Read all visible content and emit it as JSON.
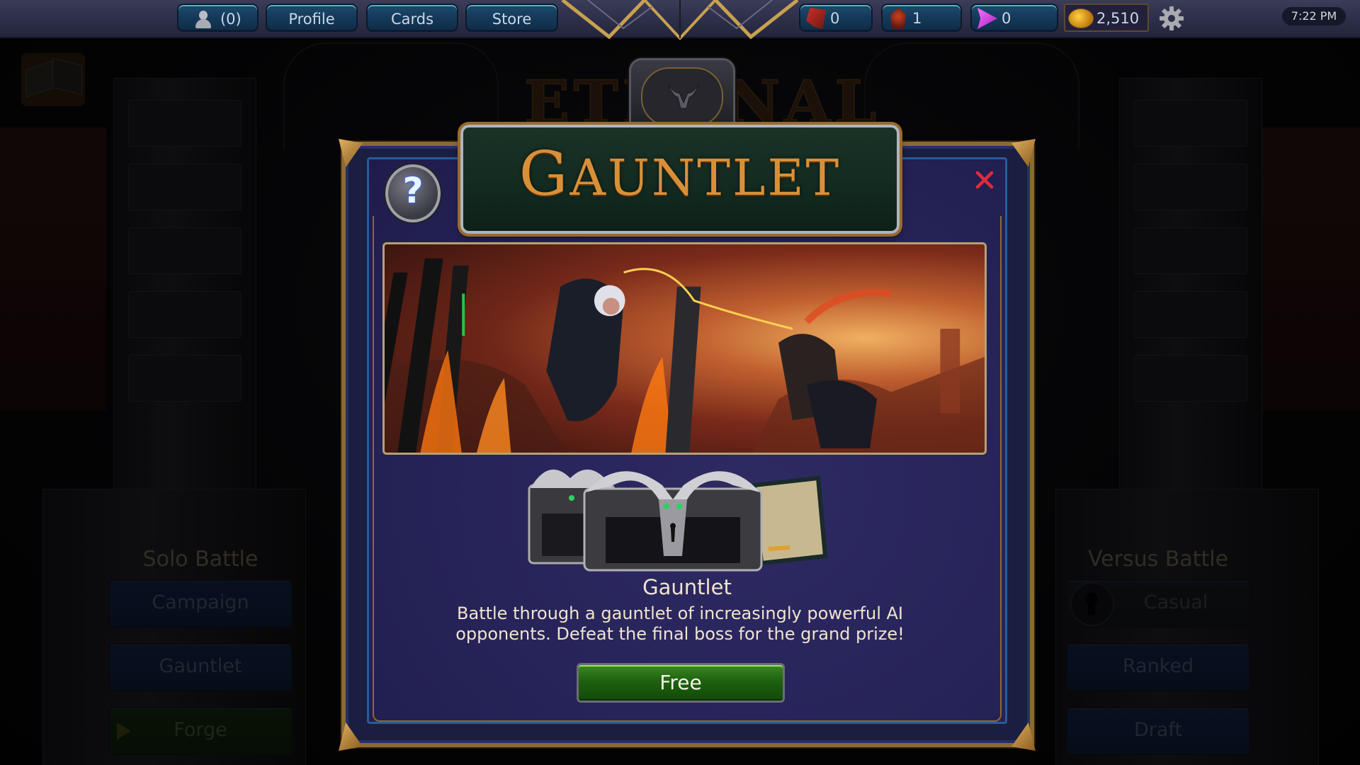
{
  "topbar": {
    "friends_count": "(0)",
    "nav": [
      {
        "label": "Profile"
      },
      {
        "label": "Cards"
      },
      {
        "label": "Store"
      }
    ],
    "currencies": [
      {
        "icon": "red-shard-icon",
        "value": "0"
      },
      {
        "icon": "orange-shard-icon",
        "value": "1"
      },
      {
        "icon": "purple-gem-icon",
        "value": "0"
      }
    ],
    "gold": {
      "icon": "gold-coin-icon",
      "value": "2,510"
    },
    "settings_icon": "gear-icon",
    "clock": "7:22 PM"
  },
  "background": {
    "logo": "ETERNAL",
    "solo_menu": {
      "title": "Solo Battle",
      "items": [
        {
          "label": "Campaign"
        },
        {
          "label": "Gauntlet"
        },
        {
          "label": "Forge"
        }
      ]
    },
    "versus_menu": {
      "title": "Versus Battle",
      "items": [
        {
          "label": "Casual",
          "locked": true
        },
        {
          "label": "Ranked"
        },
        {
          "label": "Draft"
        }
      ]
    }
  },
  "dialog": {
    "title": "Gauntlet",
    "title_display": [
      "G",
      "AUNTLET"
    ],
    "help_icon": "?",
    "close_icon": "close-icon",
    "heading": "Gauntlet",
    "description": "Battle through a gauntlet of increasingly powerful AI opponents. Defeat the final boss for the grand prize!",
    "action_button": "Free"
  },
  "colors": {
    "title_gold": "#d89038",
    "panel_purple": "#27245a",
    "free_green": "#1e6010",
    "close_red": "#e02a3a"
  }
}
